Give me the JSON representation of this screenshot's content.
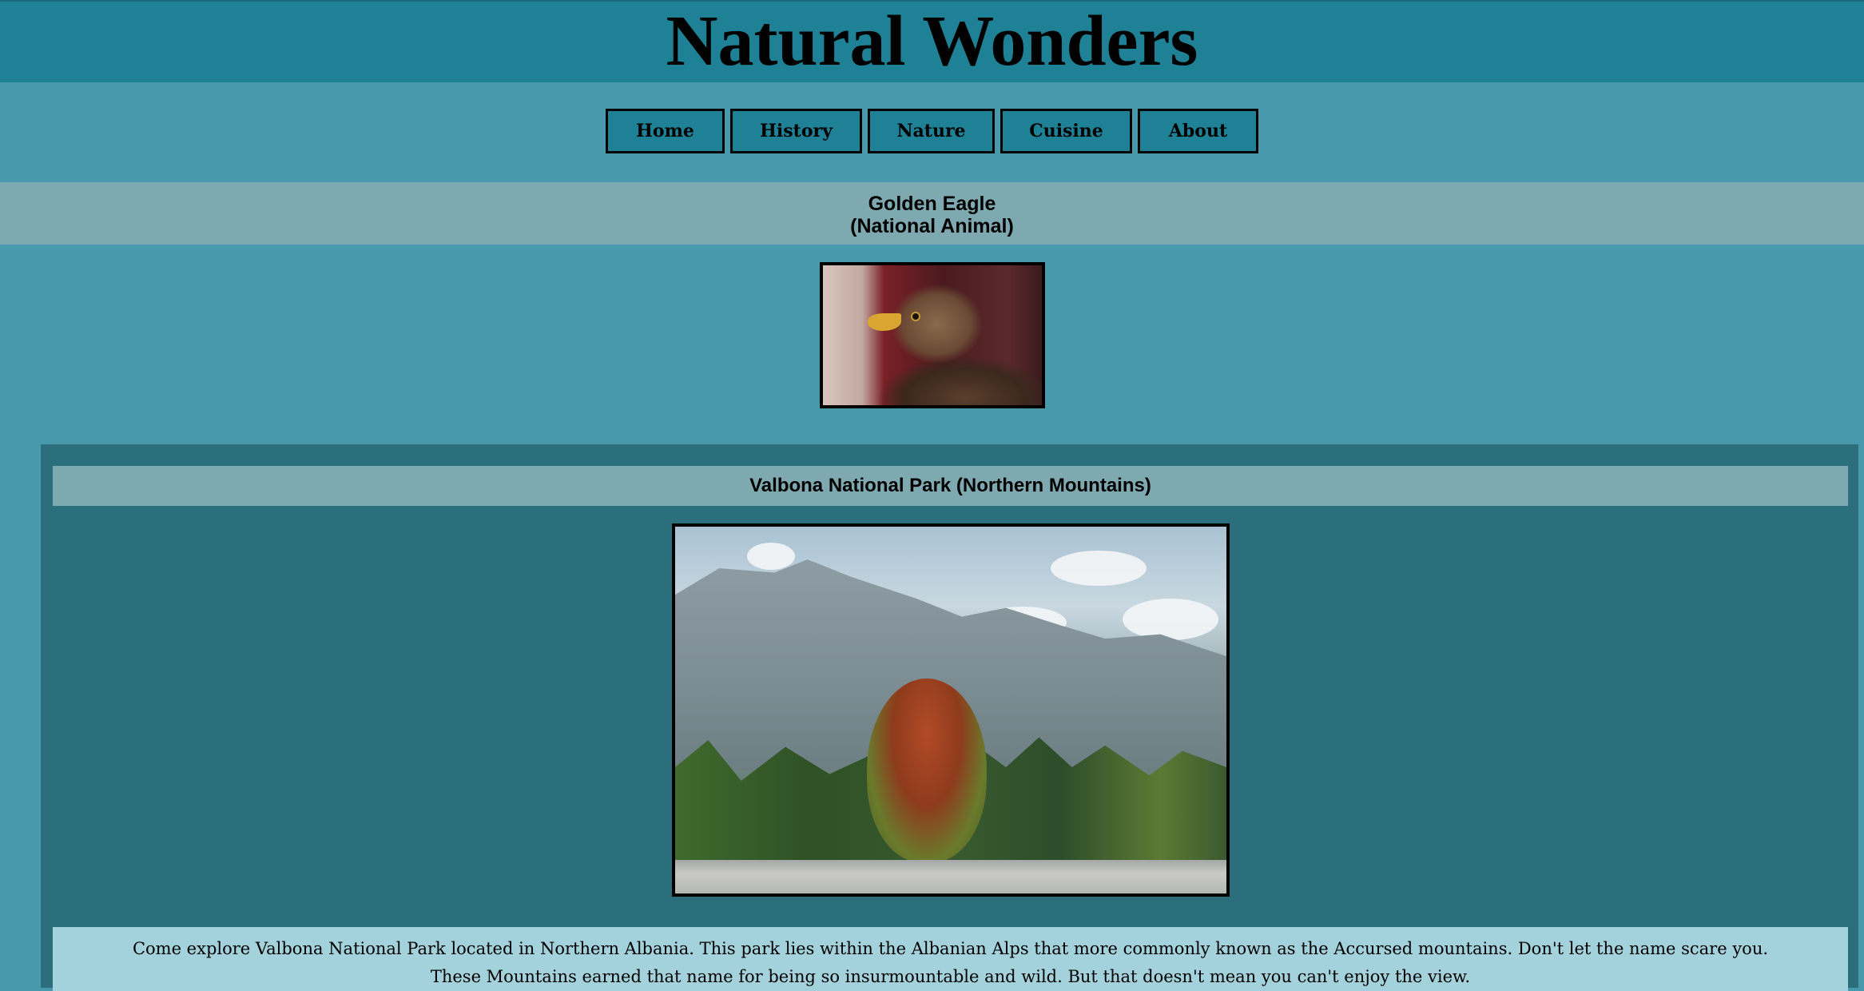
{
  "header": {
    "title": "Natural Wonders"
  },
  "nav": {
    "items": [
      {
        "label": "Home"
      },
      {
        "label": "History"
      },
      {
        "label": "Nature"
      },
      {
        "label": "Cuisine"
      },
      {
        "label": "About"
      }
    ]
  },
  "feature": {
    "title": "Golden Eagle",
    "subtitle": "(National Animal)",
    "image_alt": "golden-eagle-photo"
  },
  "park": {
    "heading": "Valbona National Park (Northern Mountains)",
    "image_alt": "valbona-mountains-photo",
    "description": "Come explore Valbona National Park located in Northern Albania. This park lies within the Albanian Alps that more commonly known as the Accursed mountains. Don't let the name scare you. These Mountains earned that name for being so insurmountable and wild. But that doesn't mean you can't enjoy the view."
  },
  "colors": {
    "header_bg": "#1f8196",
    "page_bg": "#4899ab",
    "banner_bg": "#7fa9b0",
    "panel_bg": "#2b6f7d",
    "desc_bg": "#a4d2dc"
  }
}
